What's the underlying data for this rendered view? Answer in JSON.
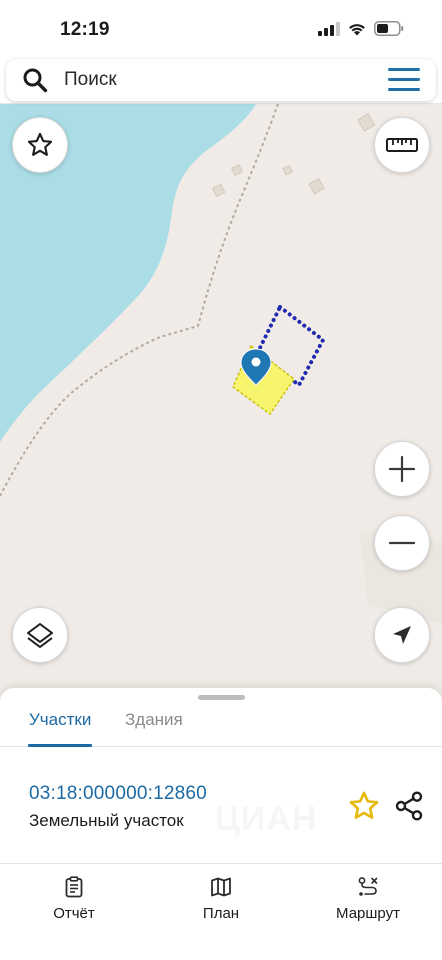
{
  "status_bar": {
    "time": "12:19",
    "icons": [
      "cellular-signal-icon",
      "wifi-icon",
      "battery-icon"
    ]
  },
  "search": {
    "placeholder": "Поиск"
  },
  "map": {
    "buttons": [
      "favorites-star-icon",
      "ruler-icon",
      "zoom-in-icon",
      "zoom-out-icon",
      "layers-icon",
      "location-arrow-icon"
    ]
  },
  "sheet": {
    "tabs": [
      {
        "label": "Участки",
        "active": true
      },
      {
        "label": "Здания",
        "active": false
      }
    ],
    "parcel": {
      "cadastral_number": "03:18:000000:12860",
      "type": "Земельный участок"
    },
    "watermark": "ЦИАН"
  },
  "bottom_nav": [
    {
      "label": "Отчёт",
      "icon": "report-icon"
    },
    {
      "label": "План",
      "icon": "map-plan-icon"
    },
    {
      "label": "Маршрут",
      "icon": "route-icon"
    }
  ],
  "colors": {
    "accent": "#1c6aa3",
    "water": "#aadde6",
    "land": "#f0ebe6",
    "parcel_fill": "#f7f56e",
    "parcel_outline": "#1f2ab0",
    "favorite_star": "#e8b90d"
  }
}
